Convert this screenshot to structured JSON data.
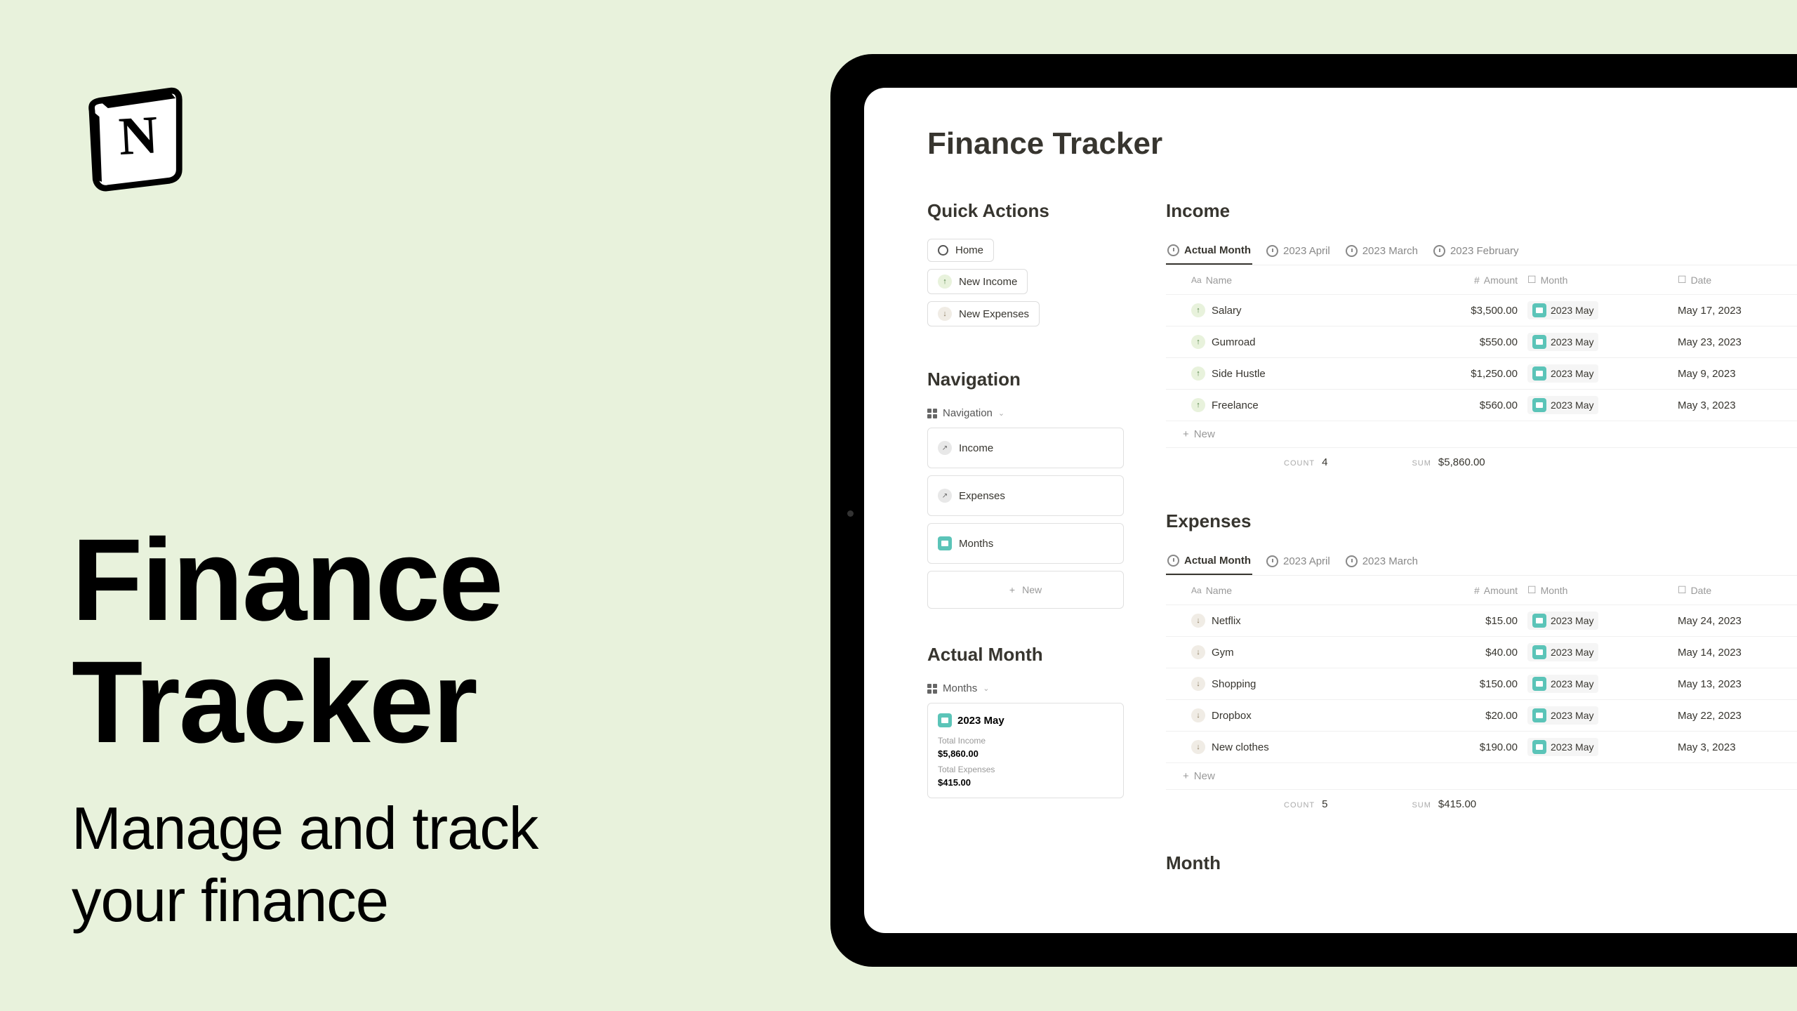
{
  "hero": {
    "title_line1": "Finance",
    "title_line2": "Tracker",
    "subtitle_line1": "Manage and track",
    "subtitle_line2": "your finance"
  },
  "app": {
    "page_title": "Finance Tracker",
    "quick_actions": {
      "heading": "Quick Actions",
      "items": [
        "Home",
        "New Income",
        "New Expenses"
      ]
    },
    "navigation": {
      "heading": "Navigation",
      "selector_label": "Navigation",
      "items": [
        "Income",
        "Expenses",
        "Months"
      ],
      "new_label": "New"
    },
    "actual_month": {
      "heading": "Actual Month",
      "selector_label": "Months",
      "card": {
        "title": "2023 May",
        "income_label": "Total Income",
        "income_value": "$5,860.00",
        "expenses_label": "Total Expenses",
        "expenses_value": "$415.00"
      }
    },
    "income": {
      "heading": "Income",
      "tabs": [
        "Actual Month",
        "2023 April",
        "2023 March",
        "2023 February"
      ],
      "columns": {
        "name": "Name",
        "amount": "Amount",
        "month": "Month",
        "date": "Date"
      },
      "rows": [
        {
          "name": "Salary",
          "amount": "$3,500.00",
          "month": "2023 May",
          "date": "May 17, 2023"
        },
        {
          "name": "Gumroad",
          "amount": "$550.00",
          "month": "2023 May",
          "date": "May 23, 2023"
        },
        {
          "name": "Side Hustle",
          "amount": "$1,250.00",
          "month": "2023 May",
          "date": "May 9, 2023"
        },
        {
          "name": "Freelance",
          "amount": "$560.00",
          "month": "2023 May",
          "date": "May 3, 2023"
        }
      ],
      "new_label": "New",
      "count_label": "COUNT",
      "count_value": "4",
      "sum_label": "SUM",
      "sum_value": "$5,860.00"
    },
    "expenses": {
      "heading": "Expenses",
      "tabs": [
        "Actual Month",
        "2023 April",
        "2023 March"
      ],
      "columns": {
        "name": "Name",
        "amount": "Amount",
        "month": "Month",
        "date": "Date"
      },
      "rows": [
        {
          "name": "Netflix",
          "amount": "$15.00",
          "month": "2023 May",
          "date": "May 24, 2023"
        },
        {
          "name": "Gym",
          "amount": "$40.00",
          "month": "2023 May",
          "date": "May 14, 2023"
        },
        {
          "name": "Shopping",
          "amount": "$150.00",
          "month": "2023 May",
          "date": "May 13, 2023"
        },
        {
          "name": "Dropbox",
          "amount": "$20.00",
          "month": "2023 May",
          "date": "May 22, 2023"
        },
        {
          "name": "New clothes",
          "amount": "$190.00",
          "month": "2023 May",
          "date": "May 3, 2023"
        }
      ],
      "new_label": "New",
      "count_label": "COUNT",
      "count_value": "5",
      "sum_label": "SUM",
      "sum_value": "$415.00"
    },
    "month_section_heading": "Month"
  }
}
